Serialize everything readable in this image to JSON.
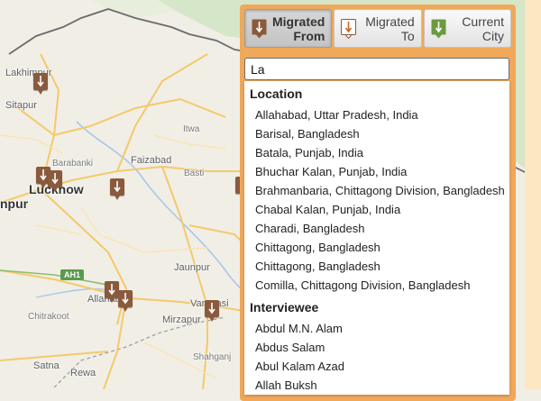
{
  "map": {
    "cities": [
      {
        "name": "Lakhimpur",
        "size": "normal"
      },
      {
        "name": "Sitapur",
        "size": "normal"
      },
      {
        "name": "Barabanki",
        "size": "small"
      },
      {
        "name": "Lucknow",
        "size": "big"
      },
      {
        "name": "Faizabad",
        "size": "normal"
      },
      {
        "name": "Basti",
        "size": "small"
      },
      {
        "name": "Itwa",
        "size": "small"
      },
      {
        "name": "Jaunpur",
        "size": "normal"
      },
      {
        "name": "Allahabad",
        "size": "normal"
      },
      {
        "name": "Varanasi",
        "size": "normal"
      },
      {
        "name": "Mirzapur",
        "size": "normal"
      },
      {
        "name": "Chitrakoot",
        "size": "small"
      },
      {
        "name": "Shahganj",
        "size": "small"
      },
      {
        "name": "Satna",
        "size": "normal"
      },
      {
        "name": "Rewa",
        "size": "normal"
      },
      {
        "name": "npur",
        "size": "big"
      }
    ],
    "highway_label": "AH1",
    "marker_color": "#8a5a3d"
  },
  "panel": {
    "accent_color": "#f0a85a",
    "tabs": [
      {
        "label_line1": "Migrated",
        "label_line2": "From",
        "icon": "arrow-down-brown-icon",
        "active": true
      },
      {
        "label_line1": "Migrated",
        "label_line2": "To",
        "icon": "arrow-down-outline-icon",
        "active": false
      },
      {
        "label_line1": "Current",
        "label_line2": "City",
        "icon": "arrow-down-green-icon",
        "active": false
      }
    ],
    "search": {
      "value": "La",
      "placeholder": ""
    },
    "groups": [
      {
        "heading": "Location",
        "items": [
          "Allahabad, Uttar Pradesh, India",
          "Barisal, Bangladesh",
          "Batala, Punjab, India",
          "Bhuchar Kalan, Punjab, India",
          "Brahmanbaria, Chittagong Division, Bangladesh",
          "Chabal Kalan, Punjab, India",
          "Charadi, Bangladesh",
          "Chittagong, Bangladesh",
          "Chittagong, Bangladesh",
          "Comilla, Chittagong Division, Bangladesh"
        ]
      },
      {
        "heading": "Interviewee",
        "items": [
          "Abdul M.N. Alam",
          "Abdus Salam",
          "Abul Kalam Azad",
          "Allah Buksh"
        ]
      }
    ]
  }
}
